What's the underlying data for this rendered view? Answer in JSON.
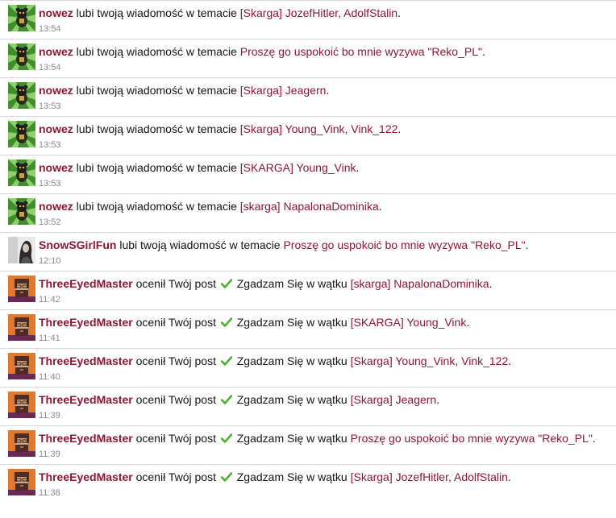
{
  "notifications": [
    {
      "avatar": "green-bear-avatar",
      "user": "nowez",
      "action": "lubi twoją wiadomość w temacie",
      "thread": "[Skarga] JozefHitler, AdolfStalin",
      "end": ".",
      "time": "13:54"
    },
    {
      "avatar": "green-bear-avatar",
      "user": "nowez",
      "action": "lubi twoją wiadomość w temacie",
      "thread": "Proszę go uspokoić bo mnie wyzywa \"Reko_PL\"",
      "end": ".",
      "time": "13:54"
    },
    {
      "avatar": "green-bear-avatar",
      "user": "nowez",
      "action": "lubi twoją wiadomość w temacie",
      "thread": "[Skarga] Jeagern",
      "end": ".",
      "time": "13:53"
    },
    {
      "avatar": "green-bear-avatar",
      "user": "nowez",
      "action": "lubi twoją wiadomość w temacie",
      "thread": "[Skarga] Young_Vink, Vink_122",
      "end": ".",
      "time": "13:53"
    },
    {
      "avatar": "green-bear-avatar",
      "user": "nowez",
      "action": "lubi twoją wiadomość w temacie",
      "thread": "[SKARGA] Young_Vink",
      "end": ".",
      "time": "13:53"
    },
    {
      "avatar": "green-bear-avatar",
      "user": "nowez",
      "action": "lubi twoją wiadomość w temacie",
      "thread": "[skarga] NapalonaDominika",
      "end": ".",
      "time": "13:52"
    },
    {
      "avatar": "grey-photo-avatar",
      "user": "SnowSGirlFun",
      "action": "lubi twoją wiadomość w temacie",
      "thread": "Proszę go uspokoić bo mnie wyzywa \"Reko_PL\"",
      "end": ".",
      "time": "12:10"
    },
    {
      "avatar": "bearded-man-avatar",
      "user": "ThreeEyedMaster",
      "action": "ocenił Twój post",
      "rating": "Zgadzam Się",
      "action2": "w wątku",
      "thread": "[skarga] NapalonaDominika",
      "end": ".",
      "time": "11:42"
    },
    {
      "avatar": "bearded-man-avatar",
      "user": "ThreeEyedMaster",
      "action": "ocenił Twój post",
      "rating": "Zgadzam Się",
      "action2": "w wątku",
      "thread": "[SKARGA] Young_Vink",
      "end": ".",
      "time": "11:41"
    },
    {
      "avatar": "bearded-man-avatar",
      "user": "ThreeEyedMaster",
      "action": "ocenił Twój post",
      "rating": "Zgadzam Się",
      "action2": "w wątku",
      "thread": "[Skarga] Young_Vink, Vink_122",
      "end": ".",
      "time": "11:40"
    },
    {
      "avatar": "bearded-man-avatar",
      "user": "ThreeEyedMaster",
      "action": "ocenił Twój post",
      "rating": "Zgadzam Się",
      "action2": "w wątku",
      "thread": "[Skarga] Jeagern",
      "end": ".",
      "time": "11:39"
    },
    {
      "avatar": "bearded-man-avatar",
      "user": "ThreeEyedMaster",
      "action": "ocenił Twój post",
      "rating": "Zgadzam Się",
      "action2": "w wątku",
      "thread": "Proszę go uspokoić bo mnie wyzywa \"Reko_PL\"",
      "end": ".",
      "time": "11:39"
    },
    {
      "avatar": "bearded-man-avatar",
      "user": "ThreeEyedMaster",
      "action": "ocenił Twój post",
      "rating": "Zgadzam Się",
      "action2": "w wątku",
      "thread": "[Skarga] JozefHitler, AdolfStalin",
      "end": ".",
      "time": "11:38"
    }
  ],
  "colors": {
    "link": "#8e1632",
    "time": "#8c8c8c",
    "divider": "#d8d8d8",
    "check": "#4caf32"
  }
}
